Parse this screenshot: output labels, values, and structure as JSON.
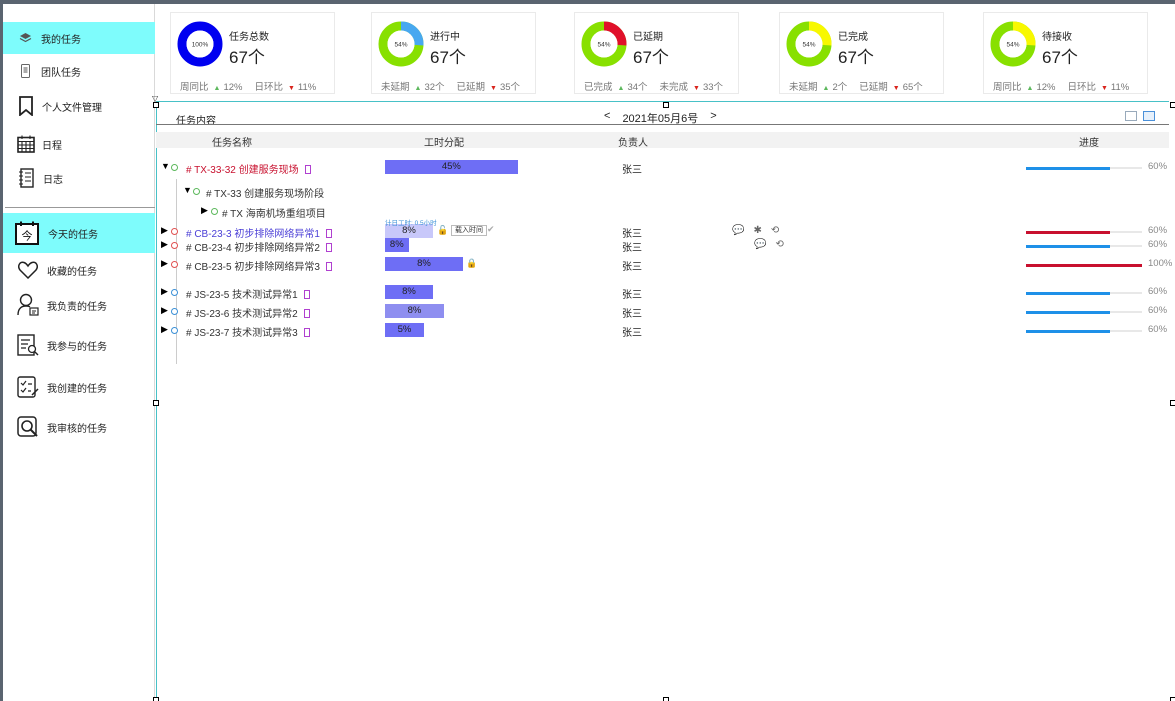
{
  "sidebar": {
    "items": [
      {
        "label": "我的任务",
        "icon": "layers-icon",
        "active": true
      },
      {
        "label": "团队任务",
        "icon": "phone-icon",
        "active": false
      },
      {
        "label": "个人文件管理",
        "icon": "bookmark-icon",
        "active": false
      },
      {
        "label": "日程",
        "icon": "calendar-grid-icon",
        "active": false
      },
      {
        "label": "日志",
        "icon": "notebook-icon",
        "active": false
      }
    ],
    "items2": [
      {
        "label": "今天的任务",
        "icon": "calendar-today-icon",
        "icon_text": "今",
        "active": true
      },
      {
        "label": "收藏的任务",
        "icon": "heart-icon",
        "active": false
      },
      {
        "label": "我负责的任务",
        "icon": "user-card-icon",
        "active": false
      },
      {
        "label": "我参与的任务",
        "icon": "list-search-icon",
        "active": false
      },
      {
        "label": "我创建的任务",
        "icon": "tasks-edit-icon",
        "active": false
      },
      {
        "label": "我审核的任务",
        "icon": "magnifier-icon",
        "active": false
      }
    ]
  },
  "stats": [
    {
      "title": "任务总数",
      "count": "67个",
      "donut_label": "100%",
      "percent": 100,
      "color": "#0000f0",
      "foot": [
        {
          "label": "周同比",
          "dir": "up",
          "value": "12%"
        },
        {
          "label": "日环比",
          "dir": "down",
          "value": "11%"
        }
      ]
    },
    {
      "title": "进行中",
      "count": "67个",
      "donut_label": "54%",
      "percent": 26,
      "color": "#48a8f0",
      "foot": [
        {
          "label": "未延期",
          "dir": "up",
          "value": "32个"
        },
        {
          "label": "已延期",
          "dir": "down",
          "value": "35个"
        }
      ]
    },
    {
      "title": "已延期",
      "count": "67个",
      "donut_label": "54%",
      "percent": 26,
      "color": "#e0102a",
      "foot": [
        {
          "label": "已完成",
          "dir": "up",
          "value": "34个"
        },
        {
          "label": "未完成",
          "dir": "down",
          "value": "33个"
        }
      ]
    },
    {
      "title": "已完成",
      "count": "67个",
      "donut_label": "54%",
      "percent": 26,
      "color": "#f8f800",
      "foot": [
        {
          "label": "未延期",
          "dir": "up",
          "value": "2个"
        },
        {
          "label": "已延期",
          "dir": "down",
          "value": "65个"
        }
      ]
    },
    {
      "title": "待接收",
      "count": "67个",
      "donut_label": "54%",
      "percent": 26,
      "color": "#f8f800",
      "foot": [
        {
          "label": "周同比",
          "dir": "up",
          "value": "12%"
        },
        {
          "label": "日环比",
          "dir": "down",
          "value": "11%"
        }
      ]
    }
  ],
  "donut_base_color": "#88e000",
  "table": {
    "title": "任务内容",
    "date": "2021年05月6号",
    "prev": "<",
    "next": ">",
    "columns": [
      "任务名称",
      "工时分配",
      "负责人",
      "进度"
    ],
    "load_btn": "载入时间",
    "hint": "计日工时: 0.5小时"
  },
  "rows": [
    {
      "name": "# TX-33-32 创建服务现场",
      "style": "red",
      "alloc": "45%",
      "alloc_value": 45,
      "owner": "张三",
      "progress": 60,
      "pct": "60%",
      "bar_color": "#1e90e8"
    },
    {
      "name": "# TX-33 创建服务现场阶段",
      "style": "normal"
    },
    {
      "name": "# TX 海南机场重组项目",
      "style": "normal"
    },
    {
      "name": "# CB-23-3 初步排除网络异常1",
      "style": "blue",
      "alloc": "8%",
      "alloc_value": 8,
      "owner": "张三",
      "progress": 60,
      "pct": "60%",
      "bar_color": "#c8102e"
    },
    {
      "name": "# CB-23-4 初步排除网络异常2",
      "style": "normal",
      "alloc": "8%",
      "alloc_value": 8,
      "owner": "张三",
      "progress": 60,
      "pct": "60%",
      "bar_color": "#1e90e8"
    },
    {
      "name": "# CB-23-5 初步排除网络异常3",
      "style": "normal",
      "alloc": "8%",
      "alloc_value": 8,
      "owner": "张三",
      "progress": 100,
      "pct": "100%",
      "bar_color": "#c8102e"
    },
    {
      "name": "# JS-23-5 技术测试异常1",
      "style": "normal",
      "alloc": "8%",
      "alloc_value": 8,
      "owner": "张三",
      "progress": 60,
      "pct": "60%",
      "bar_color": "#1e90e8"
    },
    {
      "name": "# JS-23-6 技术测试异常2",
      "style": "normal",
      "alloc": "8%",
      "alloc_value": 8,
      "owner": "张三",
      "progress": 60,
      "pct": "60%",
      "bar_color": "#1e90e8"
    },
    {
      "name": "# JS-23-7 技术测试异常3",
      "style": "normal",
      "alloc": "5%",
      "alloc_value": 5,
      "owner": "张三",
      "progress": 60,
      "pct": "60%",
      "bar_color": "#1e90e8"
    }
  ]
}
